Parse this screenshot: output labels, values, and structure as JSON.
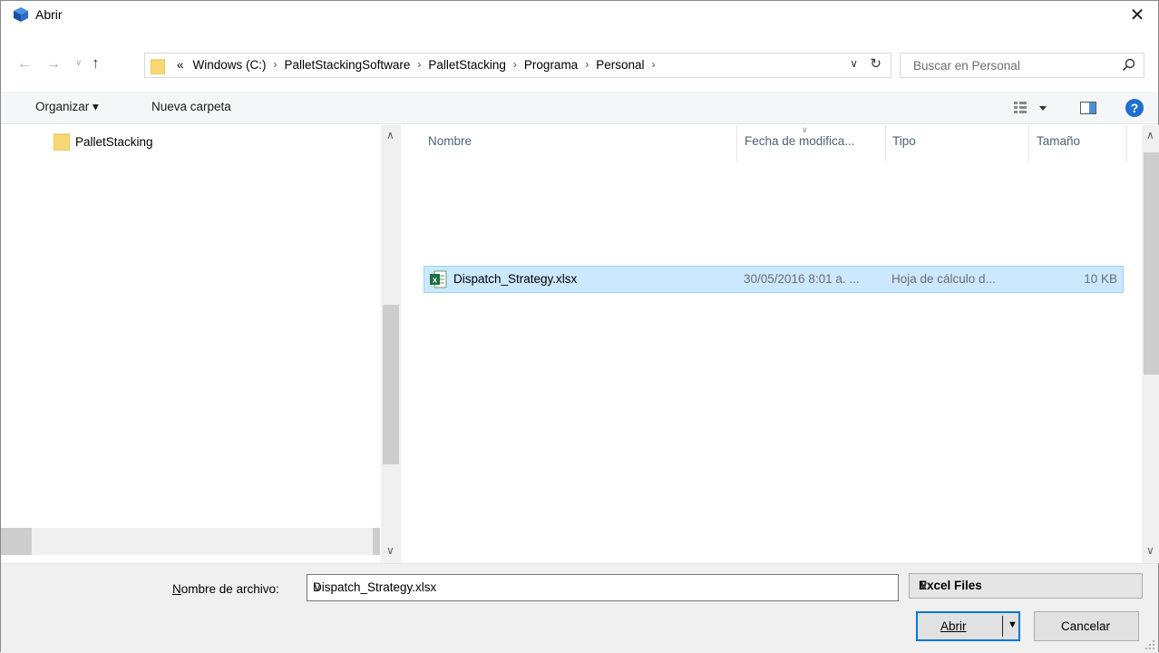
{
  "window": {
    "title": "Abrir"
  },
  "nav": {
    "overflow": "«",
    "breadcrumbs": [
      "Windows (C:)",
      "PalletStackingSoftware",
      "PalletStacking",
      "Programa",
      "Personal"
    ],
    "search_placeholder": "Buscar en Personal"
  },
  "toolbar": {
    "organize_label": "Organizar ▾",
    "new_folder_label": "Nueva carpeta"
  },
  "tree": {
    "items": [
      {
        "label": "PalletStacking"
      }
    ]
  },
  "columns": {
    "name": "Nombre",
    "date": "Fecha de modifica...",
    "type": "Tipo",
    "size": "Tamaño"
  },
  "files": [
    {
      "name": "Dispatch_Strategy.xlsx",
      "date": "30/05/2016 8:01 a. ...",
      "type": "Hoja de cálculo d...",
      "size": "10 KB",
      "selected": true
    }
  ],
  "bottom": {
    "filename_label_mnemonic": "N",
    "filename_label_rest": "ombre de archivo:",
    "filename_value": "Dispatch_Strategy.xlsx",
    "filetype_value": "Excel Files",
    "open_label": "Abrir",
    "cancel_label": "Cancelar"
  },
  "colors": {
    "selection_bg": "#cce8ff",
    "selection_border": "#99d1ff",
    "accent": "#0078d7"
  }
}
